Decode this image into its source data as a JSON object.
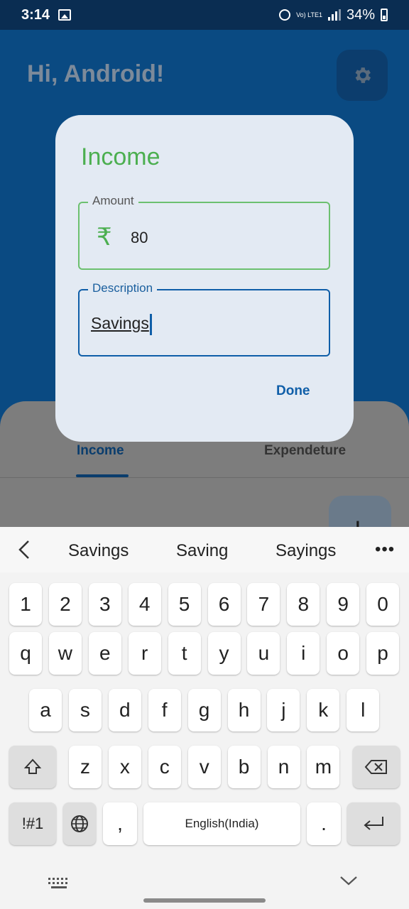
{
  "status_bar": {
    "time": "3:14",
    "network": "Vo) LTE1",
    "battery": "34%"
  },
  "app": {
    "greeting": "Hi, Android!",
    "tabs": [
      {
        "label": "Income"
      },
      {
        "label": "Expendeture"
      }
    ],
    "fab_symbol": "+"
  },
  "dialog": {
    "title": "Income",
    "amount": {
      "label": "Amount",
      "currency": "₹",
      "value": "80"
    },
    "description": {
      "label": "Description",
      "value": "Savings"
    },
    "done_label": "Done"
  },
  "keyboard": {
    "suggestions": [
      "Savings",
      "Saving",
      "Sayings"
    ],
    "more": "•••",
    "row_numbers": [
      "1",
      "2",
      "3",
      "4",
      "5",
      "6",
      "7",
      "8",
      "9",
      "0"
    ],
    "row_q": [
      "q",
      "w",
      "e",
      "r",
      "t",
      "y",
      "u",
      "i",
      "o",
      "p"
    ],
    "row_a": [
      "a",
      "s",
      "d",
      "f",
      "g",
      "h",
      "j",
      "k",
      "l"
    ],
    "row_z": [
      "z",
      "x",
      "c",
      "v",
      "b",
      "n",
      "m"
    ],
    "symbols_label": "!#1",
    "comma": ",",
    "space_label": "English(India)",
    "period": "."
  },
  "colors": {
    "accent_green": "#4caf50",
    "accent_blue": "#0f5ea8",
    "app_bg": "#0a4a82"
  }
}
